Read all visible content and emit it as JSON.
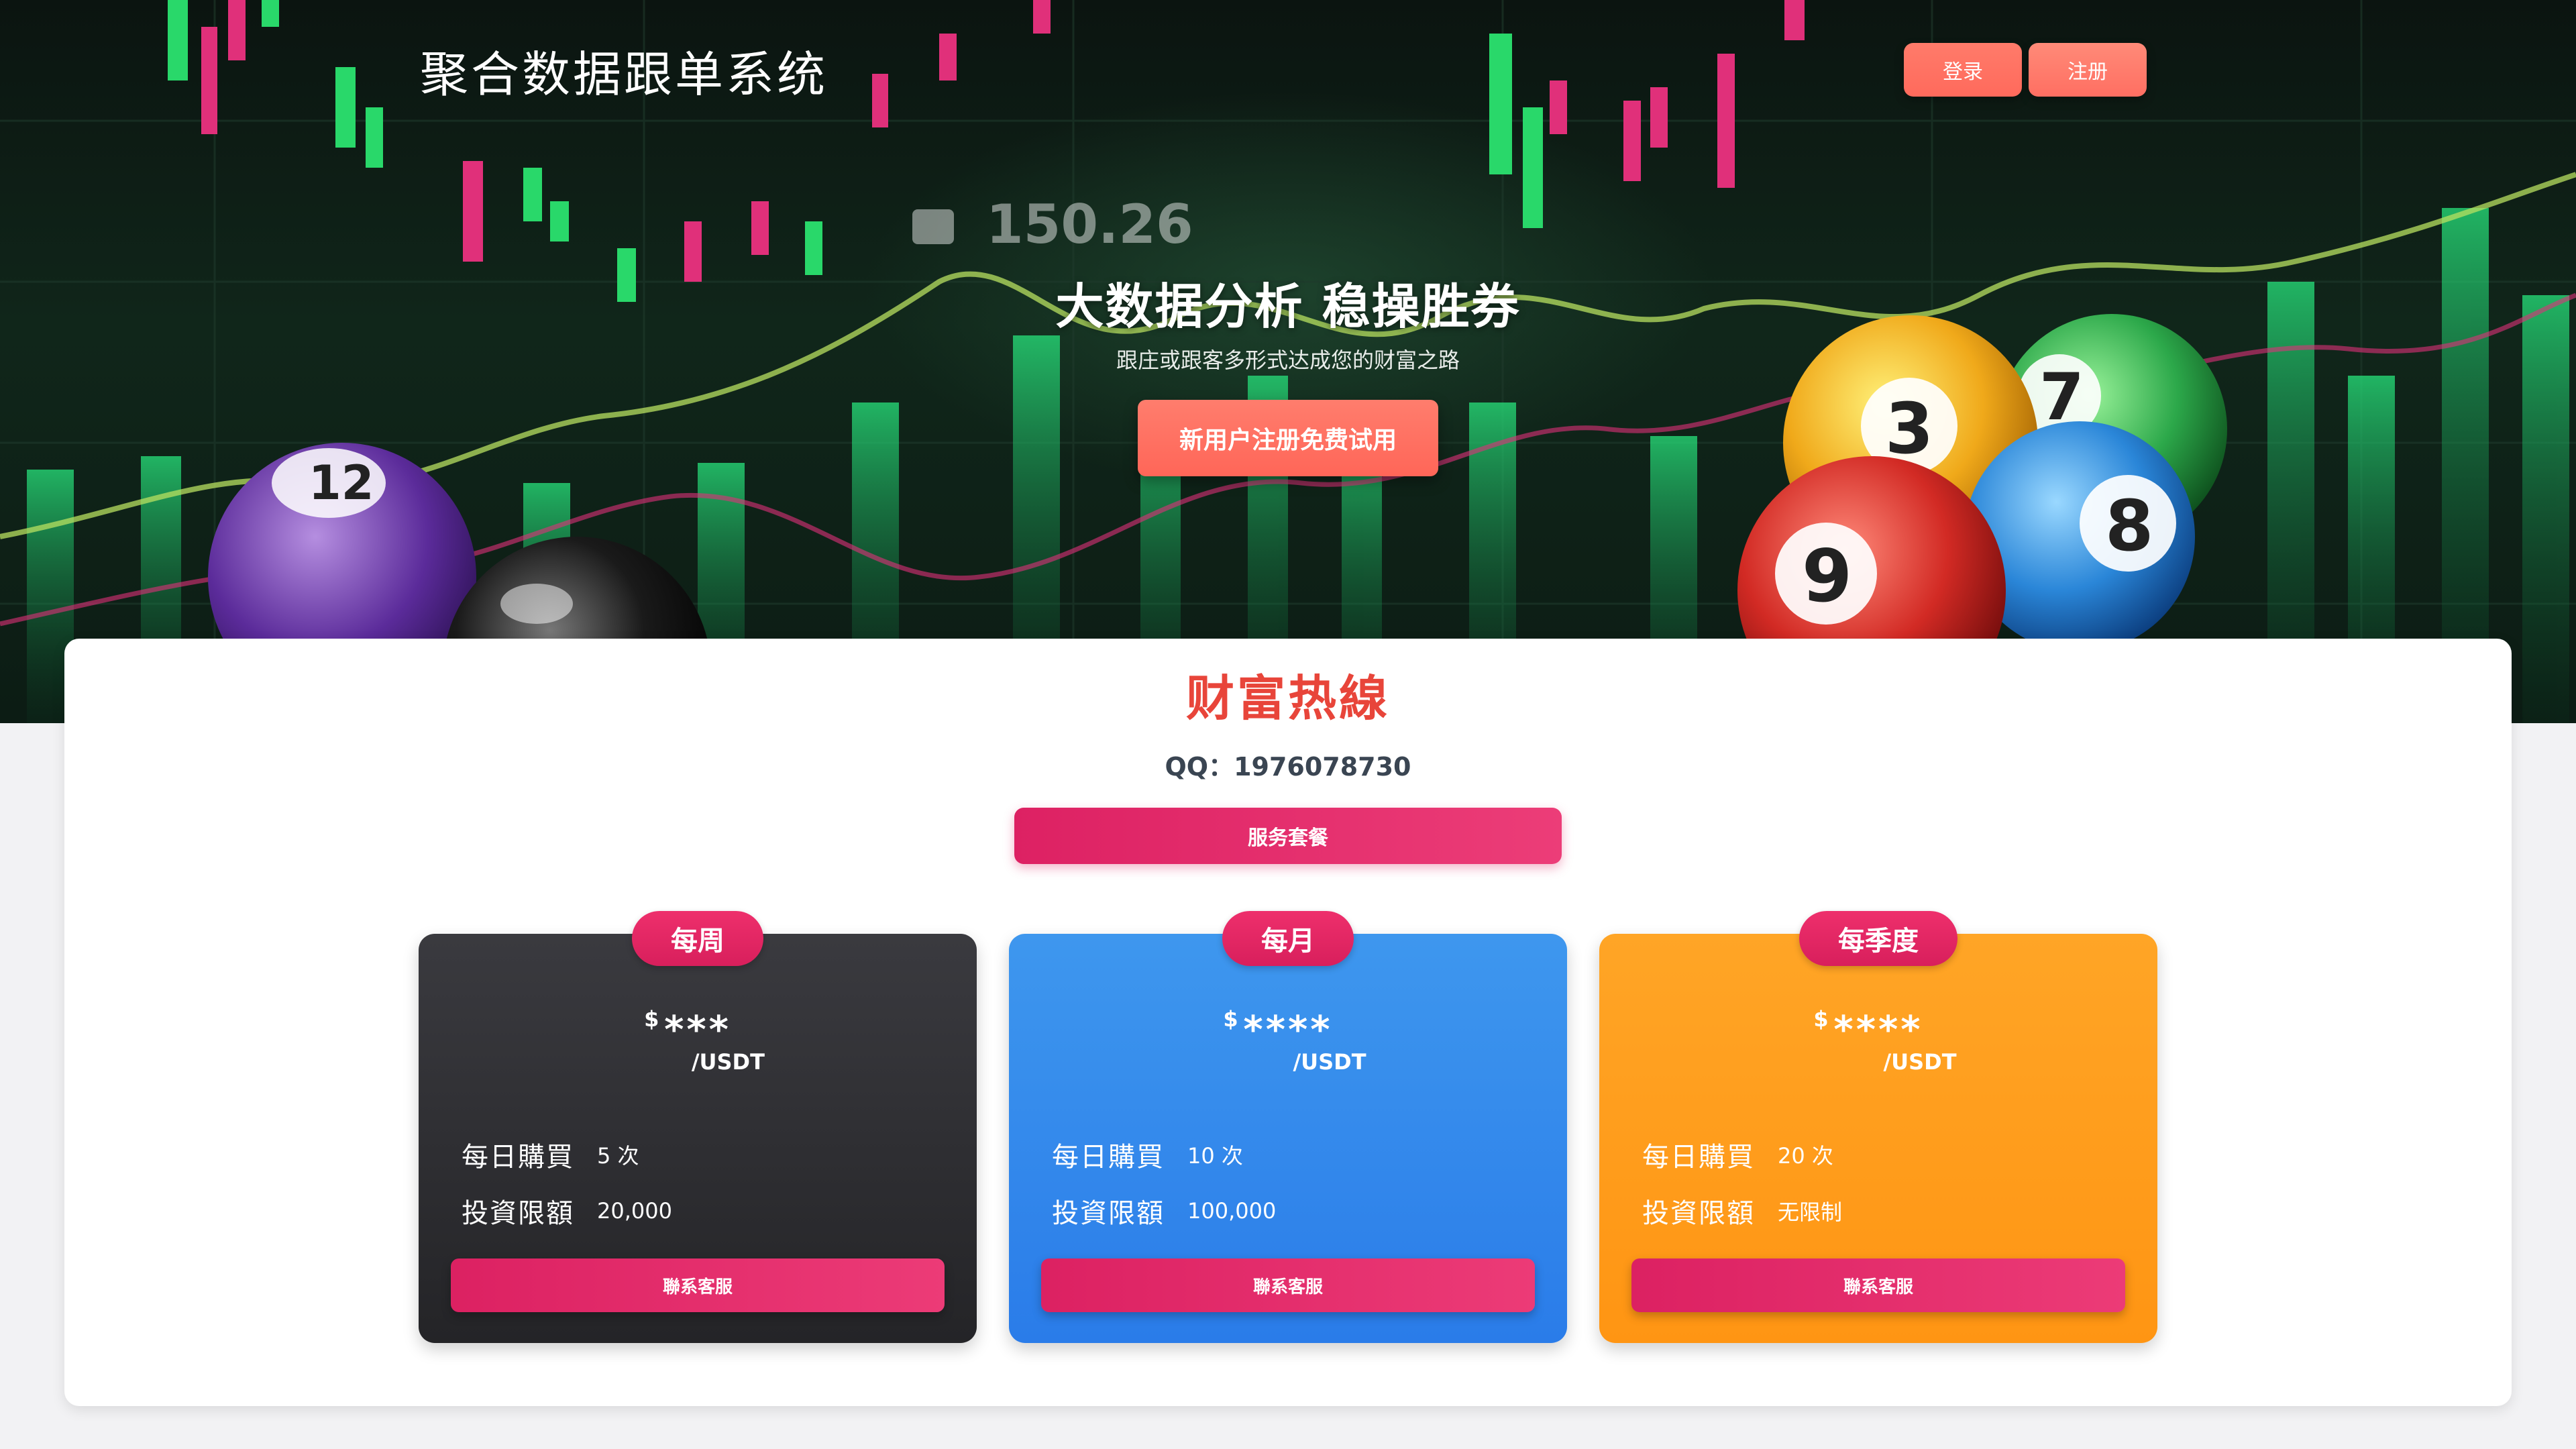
{
  "header": {
    "site_title": "聚合数据跟单系统",
    "login_label": "登录",
    "register_label": "注册"
  },
  "hero": {
    "headline": "大数据分析 稳操胜券",
    "subtitle": "跟庄或跟客多形式达成您的财富之路",
    "cta_label": "新用户注册免费试用",
    "ticker_text": "150.26",
    "ball_numbers": [
      "3",
      "7",
      "9",
      "8",
      "12"
    ]
  },
  "hotline": {
    "title": "财富热線",
    "qq": "QQ：1976078730",
    "service_label": "服务套餐"
  },
  "plans": [
    {
      "name": "每周",
      "currency": "$",
      "amount": "***",
      "unit": "/USDT",
      "daily_label": "每日購買",
      "daily_value": "5 次",
      "limit_label": "投資限額",
      "limit_value": "20,000",
      "button_label": "聯系客服"
    },
    {
      "name": "每月",
      "currency": "$",
      "amount": "****",
      "unit": "/USDT",
      "daily_label": "每日購買",
      "daily_value": "10 次",
      "limit_label": "投資限額",
      "limit_value": "100,000",
      "button_label": "聯系客服"
    },
    {
      "name": "每季度",
      "currency": "$",
      "amount": "****",
      "unit": "/USDT",
      "daily_label": "每日購買",
      "daily_value": "20 次",
      "limit_label": "投資限額",
      "limit_value": "无限制",
      "button_label": "聯系客服"
    }
  ],
  "colors": {
    "accent_pink": "#e32566",
    "hotline_red": "#e8453a",
    "weekly_bg": "#2e2e32",
    "monthly_bg": "#3489ec",
    "quarterly_bg": "#ff9c1b"
  }
}
